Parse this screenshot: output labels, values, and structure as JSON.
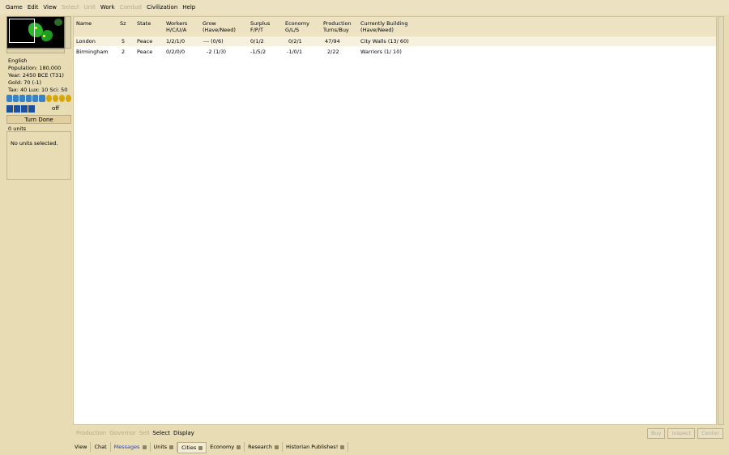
{
  "menu": [
    {
      "label": "Game",
      "enabled": true
    },
    {
      "label": "Edit",
      "enabled": true
    },
    {
      "label": "View",
      "enabled": true
    },
    {
      "label": "Select",
      "enabled": false
    },
    {
      "label": "Unit",
      "enabled": false
    },
    {
      "label": "Work",
      "enabled": true
    },
    {
      "label": "Combat",
      "enabled": false
    },
    {
      "label": "Civilization",
      "enabled": true
    },
    {
      "label": "Help",
      "enabled": true
    }
  ],
  "sidebar": {
    "nation": "English",
    "population": "Population: 180,000",
    "year": "Year: 2450 BCE (T31)",
    "gold": "Gold: 70 (-1)",
    "rates": "Tax: 40 Lux: 10 Sci: 50",
    "off": "off",
    "turn_done": "Turn Done",
    "units_count": "0 units",
    "no_units": "No units selected."
  },
  "table": {
    "headers": [
      {
        "l1": "",
        "l2": "Name"
      },
      {
        "l1": "",
        "l2": "Sz"
      },
      {
        "l1": "",
        "l2": "State"
      },
      {
        "l1": "Workers",
        "l2": "H/C/U/A"
      },
      {
        "l1": "Grow",
        "l2": "(Have/Need)"
      },
      {
        "l1": "Surplus",
        "l2": "F/P/T"
      },
      {
        "l1": "Economy",
        "l2": "G/L/S"
      },
      {
        "l1": "Production",
        "l2": "Turns/Buy"
      },
      {
        "l1": "Currently Building",
        "l2": "(Have/Need)"
      }
    ],
    "rows": [
      [
        "London",
        "5",
        "Peace",
        "1/2/1/0",
        "--- (0/6)",
        "0/1/2",
        "0/2/1",
        "47/94",
        "City Walls (13/ 60)"
      ],
      [
        "Birmingham",
        "2",
        "Peace",
        "0/2/0/0",
        "-2 (1/3)",
        "-1/5/2",
        "-1/0/1",
        "2/22",
        "Warriors (1/ 10)"
      ]
    ]
  },
  "commands": {
    "production": "Production",
    "governor": "Governor",
    "sell": "Sell",
    "select": "Select",
    "display": "Display",
    "buy": "Buy",
    "inspect": "Inspect",
    "center": "Center"
  },
  "tabs": [
    {
      "label": "View",
      "closable": false
    },
    {
      "label": "Chat",
      "closable": false
    },
    {
      "label": "Messages",
      "closable": true,
      "highlight": true
    },
    {
      "label": "Units",
      "closable": true
    },
    {
      "label": "Cities",
      "closable": true,
      "active": true
    },
    {
      "label": "Economy",
      "closable": true
    },
    {
      "label": "Research",
      "closable": true
    },
    {
      "label": "Historian Publishes!",
      "closable": true
    }
  ]
}
